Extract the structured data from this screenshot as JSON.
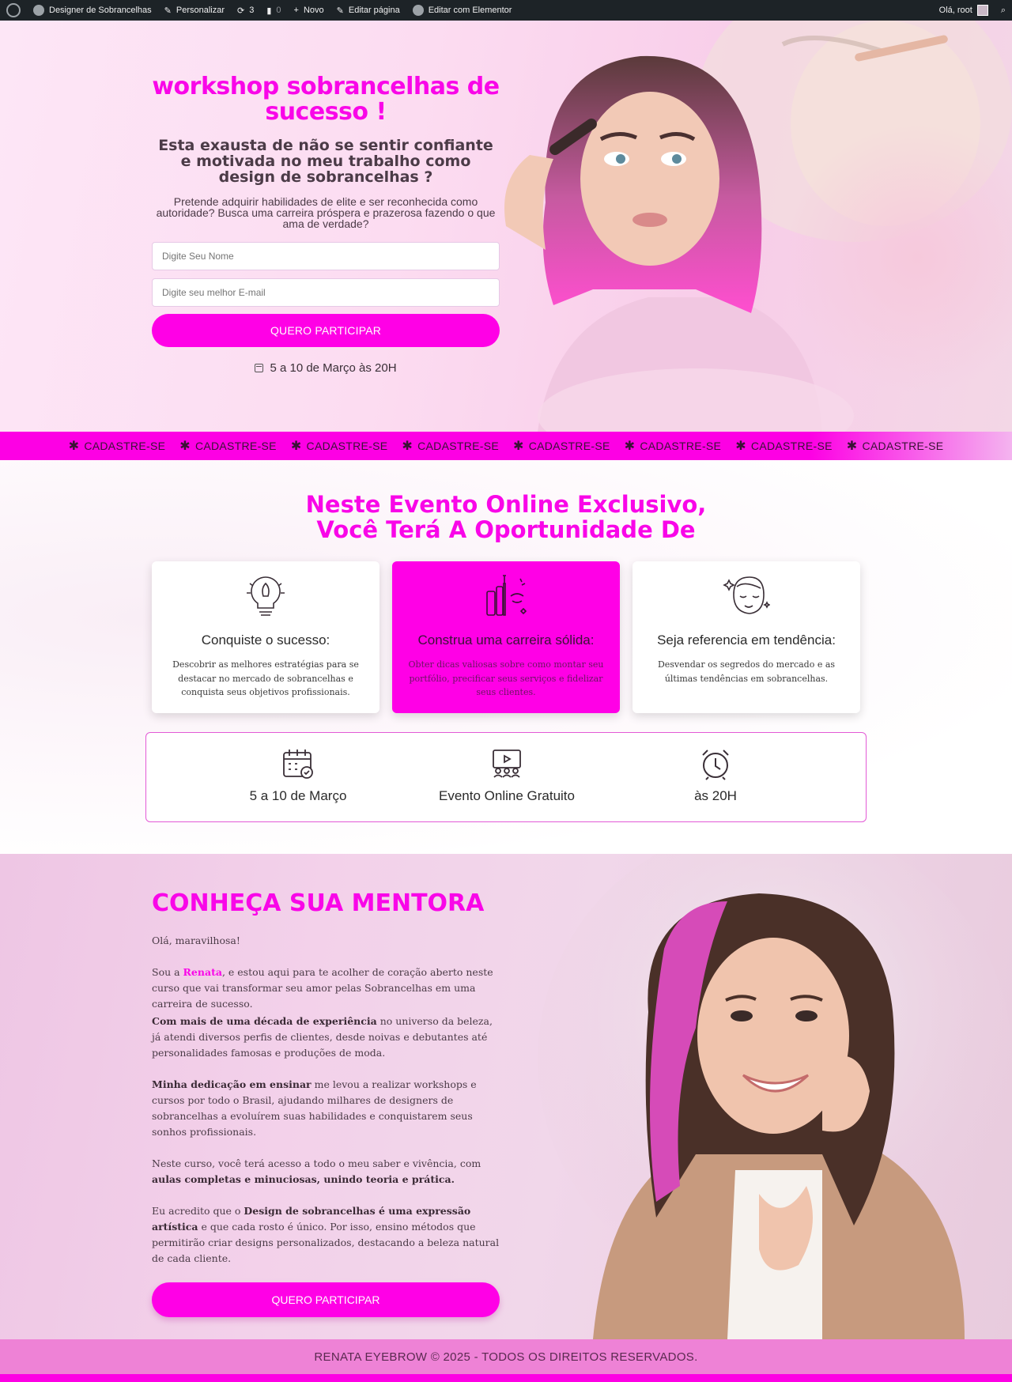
{
  "adminbar": {
    "site_name": "Designer de Sobrancelhas",
    "customize": "Personalizar",
    "updates_count": "3",
    "comments_count": "0",
    "new": "Novo",
    "edit_page": "Editar página",
    "edit_elementor": "Editar com Elementor",
    "greeting": "Olá, root"
  },
  "hero": {
    "title": "workshop sobrancelhas de sucesso !",
    "subtitle": "Esta exausta de não se sentir confiante e motivada no meu trabalho como design de sobrancelhas ?",
    "text": "Pretende adquirir habilidades de elite e ser reconhecida como autoridade? Busca uma carreira próspera e prazerosa fazendo o que ama de verdade?",
    "name_placeholder": "Digite Seu Nome",
    "email_placeholder": "Digite seu melhor E-mail",
    "button": "QUERO PARTICIPAR",
    "date": "5 a 10 de Março às 20H"
  },
  "ticker": {
    "items": [
      "CADASTRE-SE",
      "CADASTRE-SE",
      "CADASTRE-SE",
      "CADASTRE-SE",
      "CADASTRE-SE",
      "CADASTRE-SE",
      "CADASTRE-SE",
      "CADASTRE-SE"
    ]
  },
  "event": {
    "title_line1": "Neste Evento Online Exclusivo,",
    "title_line2": "Você Terá A Oportunidade De",
    "cards": [
      {
        "icon": "rocket-lightbulb-icon",
        "title": "Conquiste o sucesso:",
        "text": "Descobrir as melhores estratégias para se destacar no mercado de sobrancelhas e conquista seus objetivos profissionais."
      },
      {
        "icon": "makeup-tools-icon",
        "title": "Construa uma carreira sólida:",
        "text": "Obter dicas valiosas sobre como montar seu portfólio, precificar seus serviços e fidelizar seus clientes."
      },
      {
        "icon": "face-sparkle-icon",
        "title": "Seja referencia em tendência:",
        "text": "Desvendar os segredos do mercado e as últimas tendências em sobrancelhas."
      }
    ],
    "info": [
      {
        "icon": "calendar-check-icon",
        "label": "5 a 10 de Março"
      },
      {
        "icon": "online-event-icon",
        "label": "Evento Online Gratuito"
      },
      {
        "icon": "alarm-clock-icon",
        "label": "às 20H"
      }
    ]
  },
  "mentor": {
    "title": "CONHEÇA SUA MENTORA",
    "greeting": "Olá, maravilhosa!",
    "p1_a": "Sou a ",
    "p1_name": "Renata",
    "p1_b": ", e estou aqui para te acolher de coração aberto neste curso que vai transformar seu amor pelas Sobrancelhas em uma carreira de sucesso.",
    "p2_bold": "Com mais de uma década de experiência",
    "p2_rest": " no universo da beleza, já atendi diversos perfis de clientes, desde noivas e debutantes até personalidades famosas e produções de moda.",
    "p3_bold": "Minha dedicação em ensinar",
    "p3_rest": " me levou a realizar workshops e cursos por todo o Brasil, ajudando milhares de designers de sobrancelhas a evoluírem suas habilidades e conquistarem seus sonhos profissionais.",
    "p4_a": "Neste curso, você terá acesso a todo o meu saber e vivência, com ",
    "p4_bold": "aulas completas e minuciosas, unindo teoria e prática.",
    "p5_a": "Eu acredito que o ",
    "p5_bold": "Design de sobrancelhas é uma expressão artística",
    "p5_rest": " e que cada rosto é único. Por isso, ensino métodos que permitirão criar designs personalizados, destacando a beleza natural de cada cliente.",
    "button": "QUERO PARTICIPAR"
  },
  "footer": {
    "text": "RENATA EYEBROW © 2025 - TODOS OS DIREITOS RESERVADOS."
  }
}
